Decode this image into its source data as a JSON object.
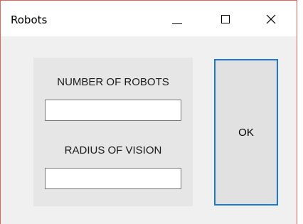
{
  "window": {
    "title": "Robots",
    "controls": {
      "minimize": "minimize-icon",
      "maximize": "maximize-icon",
      "close": "close-icon"
    },
    "border_color": "#e0665d"
  },
  "form": {
    "robots_label": "NUMBER OF ROBOTS",
    "robots_value": "",
    "radius_label": "RADIUS OF VISION",
    "radius_value": ""
  },
  "actions": {
    "ok_label": "OK",
    "ok_focus_color": "#1c78d4"
  }
}
